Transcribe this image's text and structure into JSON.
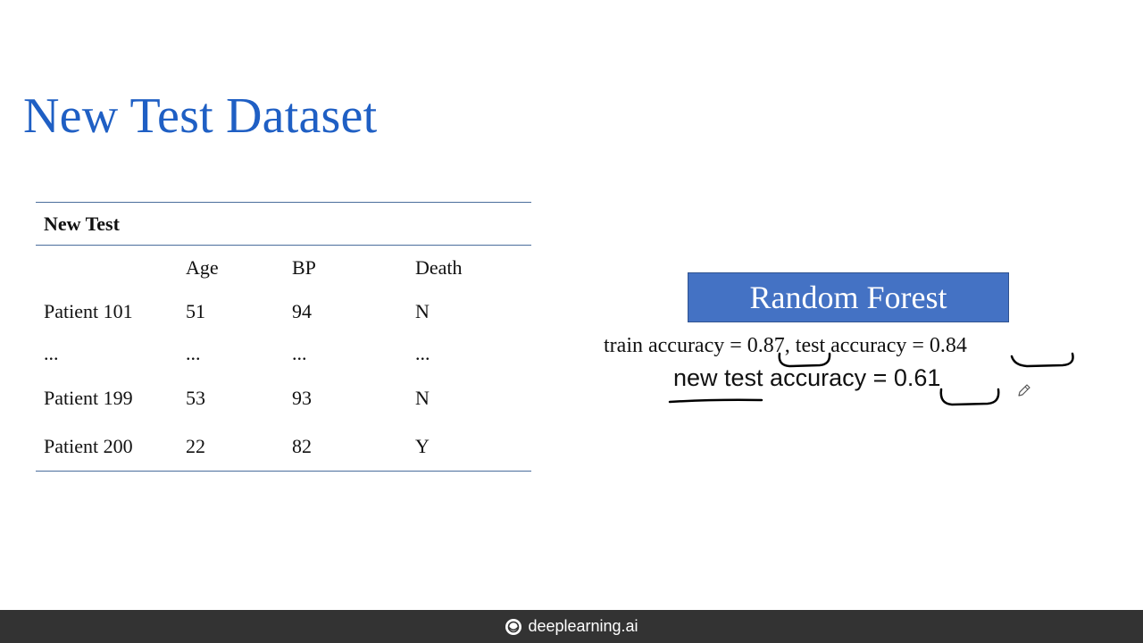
{
  "slide": {
    "title": "New Test Dataset"
  },
  "table": {
    "caption": "New Test",
    "headers": [
      "",
      "Age",
      "BP",
      "Death"
    ],
    "rows": [
      [
        "Patient 101",
        "51",
        "94",
        "N"
      ],
      [
        "...",
        "...",
        "...",
        "..."
      ],
      [
        "Patient 199",
        "53",
        "93",
        "N"
      ],
      [
        "Patient 200",
        "22",
        "82",
        "Y"
      ]
    ]
  },
  "model": {
    "name": "Random Forest",
    "train_label": "train accuracy = ",
    "train_value": "0.87",
    "separator": ", ",
    "test_label": "test accuracy = ",
    "test_value": "0.84",
    "new_test_label": "new test accuracy = ",
    "new_test_value": "0.61"
  },
  "footer": {
    "brand": "deeplearning.ai"
  },
  "icons": {
    "brand_logo": "deeplearning-logo-icon",
    "cursor": "pen-cursor-icon"
  },
  "colors": {
    "title": "#1f5fc4",
    "model_box": "#4472c4",
    "table_rule": "#4a6d9c",
    "footer": "#333333"
  }
}
